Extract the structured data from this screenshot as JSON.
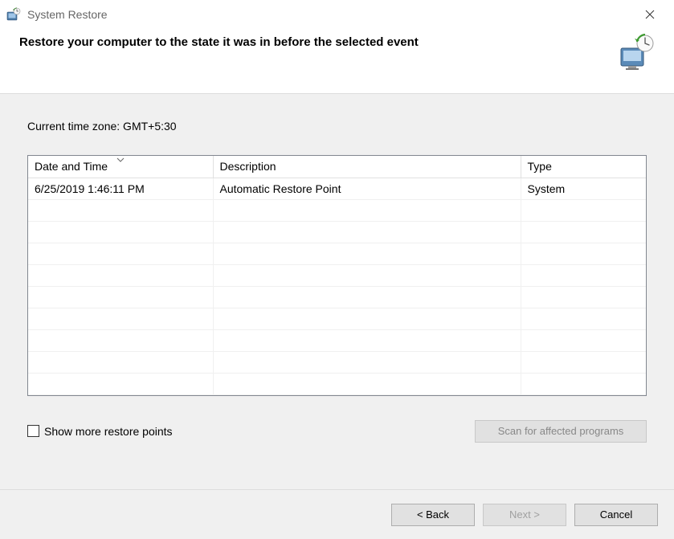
{
  "titlebar": {
    "title": "System Restore"
  },
  "header": {
    "title": "Restore your computer to the state it was in before the selected event"
  },
  "content": {
    "timezone": "Current time zone: GMT+5:30",
    "columns": {
      "datetime": "Date and Time",
      "description": "Description",
      "type": "Type"
    },
    "rows": [
      {
        "datetime": "6/25/2019 1:46:11 PM",
        "description": "Automatic Restore Point",
        "type": "System"
      }
    ],
    "checkbox_label": "Show more restore points",
    "scan_label": "Scan for affected programs"
  },
  "footer": {
    "back": "< Back",
    "next": "Next >",
    "cancel": "Cancel"
  }
}
